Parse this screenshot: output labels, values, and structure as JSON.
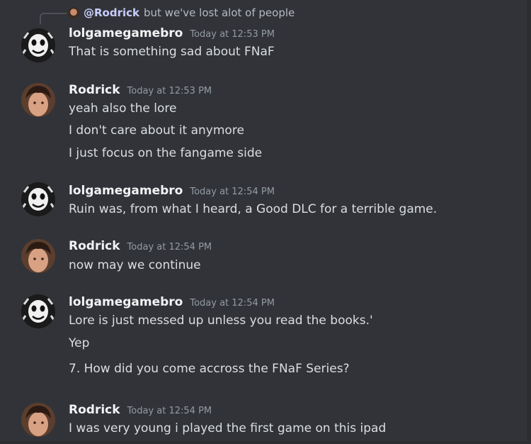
{
  "reply": {
    "mention": "@Rodrick",
    "text": "but we've lost alot of people"
  },
  "messages": [
    {
      "author": "lolgamegamebro",
      "time": "Today at 12:53 PM",
      "avatar_icon": "puppet-mask-icon",
      "lines": [
        "That is something sad about FNaF"
      ]
    },
    {
      "author": "Rodrick",
      "time": "Today at 12:53 PM",
      "avatar_icon": "rodrick-photo-avatar",
      "lines": [
        "yeah also the lore",
        "I don't care about it anymore",
        "I just focus on the fangame side"
      ]
    },
    {
      "author": "lolgamegamebro",
      "time": "Today at 12:54 PM",
      "avatar_icon": "puppet-mask-icon",
      "lines": [
        "Ruin was, from what I heard, a Good DLC for a terrible game."
      ]
    },
    {
      "author": "Rodrick",
      "time": "Today at 12:54 PM",
      "avatar_icon": "rodrick-photo-avatar",
      "lines": [
        "now may we continue"
      ]
    },
    {
      "author": "lolgamegamebro",
      "time": "Today at 12:54 PM",
      "avatar_icon": "puppet-mask-icon",
      "lines": [
        "Lore is just messed up unless you read the books.'",
        "Yep",
        "7. How did you come accross the FNaF Series?"
      ]
    },
    {
      "author": "Rodrick",
      "time": "Today at 12:54 PM",
      "avatar_icon": "rodrick-photo-avatar",
      "lines": [
        "I was very young i played the first game on this ipad"
      ]
    }
  ],
  "colors": {
    "background": "#313338",
    "text": "#dbdee1",
    "username": "#f2f3f5",
    "timestamp": "#949ba4",
    "mention": "#c9cdfb"
  }
}
